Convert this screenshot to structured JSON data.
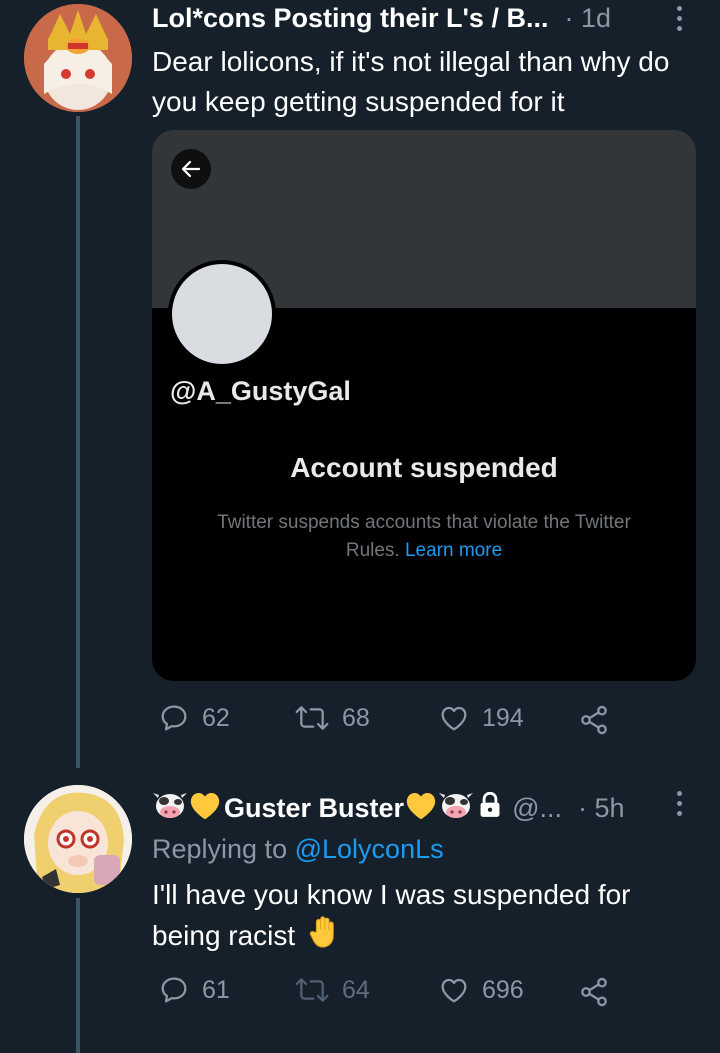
{
  "tweets": [
    {
      "author_name": "Lol*cons Posting their L's / B...",
      "time": "· 1d",
      "text": "Dear lolicons, if it's not illegal than why do you keep getting suspended for it",
      "card": {
        "handle": "@A_GustyGal",
        "title": "Account suspended",
        "body": "Twitter suspends accounts that violate the Twitter Rules.",
        "link": "Learn more"
      },
      "stats": {
        "replies": "62",
        "retweets": "68",
        "likes": "194"
      }
    },
    {
      "author_name": "Guster Buster",
      "handle": "@...",
      "time": "· 5h",
      "replying_prefix": "Replying to",
      "replying_handle": "@LolyconLs",
      "text": "I'll have you know I was suspended for being racist",
      "stats": {
        "replies": "61",
        "retweets": "64",
        "likes": "696"
      }
    }
  ],
  "icons": [
    "reply-icon",
    "retweet-icon",
    "like-icon",
    "share-icon",
    "more-icon",
    "lock-icon",
    "back-arrow-icon",
    "cow-emoji",
    "yellow-heart-emoji",
    "raised-hand-emoji"
  ],
  "colors": {
    "background": "#15202b",
    "link": "#1d9bf0",
    "muted": "#8b98a5"
  }
}
